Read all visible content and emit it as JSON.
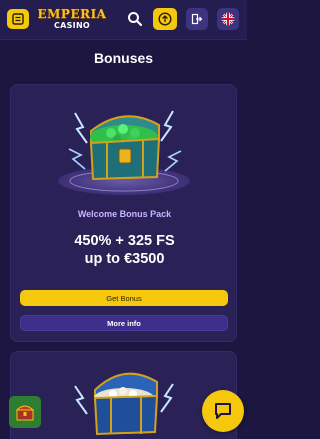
{
  "header": {
    "logo_main": "EMPERIA",
    "logo_sub": "CASINO",
    "menu_icon": "menu-icon",
    "search_icon": "search-icon",
    "promo_icon": "promo-icon",
    "login_icon": "login-icon",
    "language_icon": "uk-flag-icon"
  },
  "page": {
    "title": "Bonuses"
  },
  "bonus_cards": [
    {
      "subtitle": "Welcome Bonus Pack",
      "offer_line1": "450% + 325 FS",
      "offer_line2": "up to €3500",
      "primary_button": "Get Bonus",
      "secondary_button": "More info",
      "image_icon": "treasure-chest-emeralds-icon"
    },
    {
      "image_icon": "treasure-chest-pearls-icon"
    }
  ],
  "floating": {
    "chest_icon": "treasure-chest-icon",
    "chat_icon": "chat-icon"
  },
  "colors": {
    "background": "#1c1640",
    "card": "#2a2257",
    "accent_yellow": "#f5c80e",
    "secondary_button": "#3e2f8c",
    "subtitle": "#c9b4ff"
  }
}
